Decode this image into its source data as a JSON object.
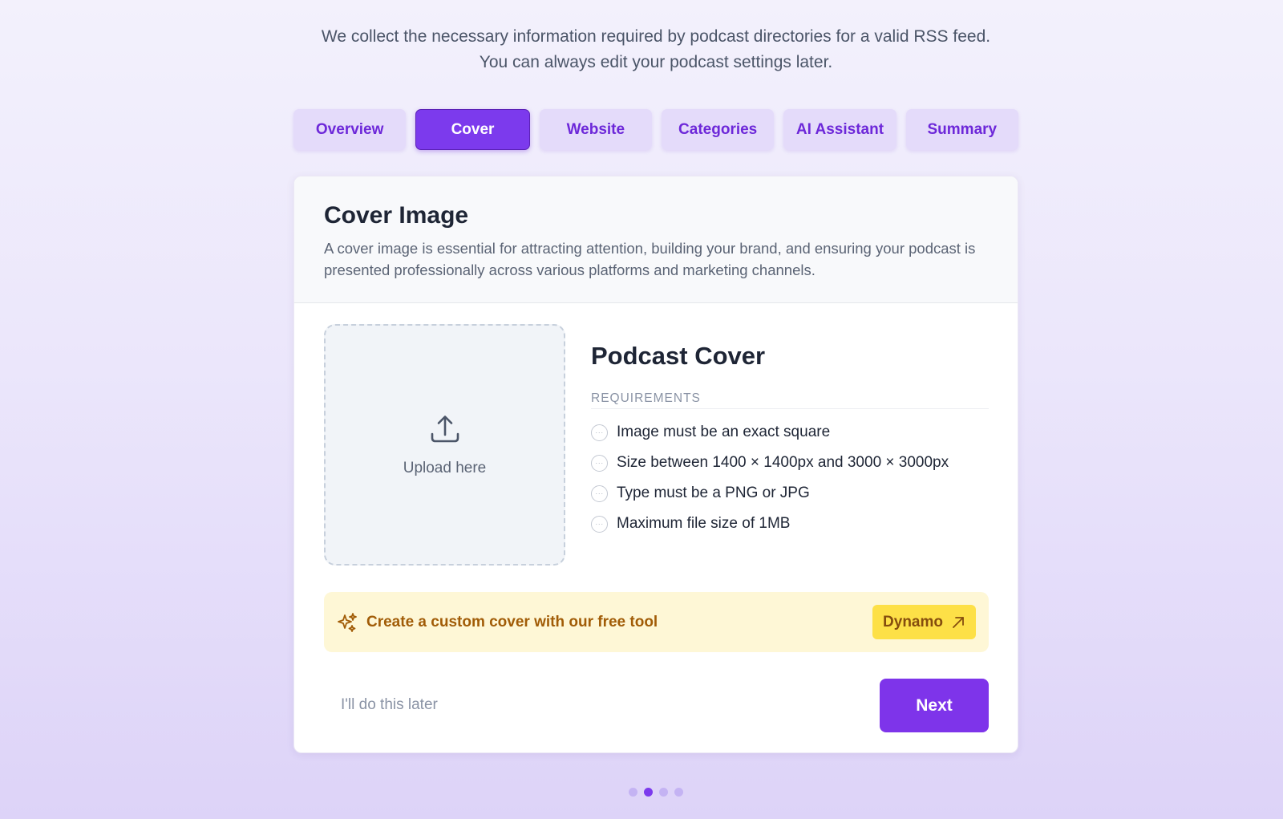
{
  "page": {
    "intro": "We collect the necessary information required by podcast directories for a valid RSS feed. You can always edit your podcast settings later."
  },
  "tabs": [
    {
      "label": "Overview",
      "active": false
    },
    {
      "label": "Cover",
      "active": true
    },
    {
      "label": "Website",
      "active": false
    },
    {
      "label": "Categories",
      "active": false
    },
    {
      "label": "AI Assistant",
      "active": false
    },
    {
      "label": "Summary",
      "active": false
    }
  ],
  "card": {
    "title": "Cover Image",
    "description": "A cover image is essential for attracting attention, building your brand, and ensuring your podcast is presented professionally across various platforms and marketing channels.",
    "upload": {
      "label": "Upload here",
      "icon": "upload-icon"
    },
    "info_title": "Podcast Cover",
    "requirements_label": "REQUIREMENTS",
    "requirements": [
      "Image must be an exact square",
      "Size between 1400 × 1400px and 3000 × 3000px",
      "Type must be a PNG or JPG",
      "Maximum file size of 1MB"
    ],
    "promo": {
      "text": "Create a custom cover with our free tool",
      "button_label": "Dynamo",
      "icon": "sparkle-icon",
      "button_icon": "arrow-up-right-icon"
    },
    "later_label": "I'll do this later",
    "next_label": "Next"
  },
  "pagination": {
    "total": 4,
    "current": 2
  },
  "colors": {
    "accent": "#7c3aed",
    "tab_inactive_bg": "#e4dbfa",
    "promo_bg": "#fef7d6",
    "promo_button_bg": "#fde047"
  }
}
